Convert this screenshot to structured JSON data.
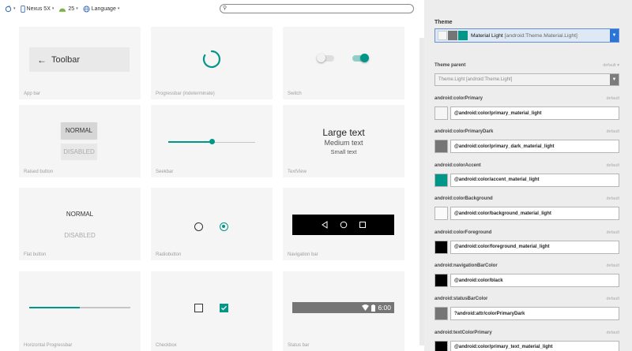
{
  "toolbar": {
    "device": "Nexus 5X",
    "api": "25",
    "language": "Language"
  },
  "cards": [
    {
      "name": "app-bar",
      "label": "App bar",
      "toolbar_title": "Toolbar"
    },
    {
      "name": "progressbar",
      "label": "Progressbar (indeterminate)"
    },
    {
      "name": "switch",
      "label": "Switch"
    },
    {
      "name": "raised-button",
      "label": "Raised button",
      "normal": "NORMAL",
      "disabled": "DISABLED"
    },
    {
      "name": "seekbar",
      "label": "Seekbar",
      "progress": 0.5
    },
    {
      "name": "textview",
      "label": "TextView",
      "large": "Large text",
      "medium": "Medium text",
      "small": "Small text"
    },
    {
      "name": "flat-button",
      "label": "Flat button",
      "normal": "NORMAL",
      "disabled": "DISABLED"
    },
    {
      "name": "radiobutton",
      "label": "Radiobutton"
    },
    {
      "name": "navigation-bar",
      "label": "Navigation bar"
    },
    {
      "name": "horizontal-progressbar",
      "label": "Horizontal Progressbar",
      "progress": 0.5
    },
    {
      "name": "checkbox",
      "label": "Checkbox"
    },
    {
      "name": "status-bar",
      "label": "Status bar",
      "time": "6:00"
    }
  ],
  "panel": {
    "theme_label": "Theme",
    "theme_value": "Material Light",
    "theme_value_detail": "[android:Theme.Material.Light]",
    "theme_parent_label": "Theme parent",
    "theme_parent_default": "default",
    "theme_parent_value": "Theme.Light [android:Theme.Light]",
    "attributes": [
      {
        "name": "android:colorPrimary",
        "default": "default",
        "value": "@android:color/primary_material_light",
        "color": "#f5f5f5"
      },
      {
        "name": "android:colorPrimaryDark",
        "default": "default",
        "value": "@android:color/primary_dark_material_light",
        "color": "#757575"
      },
      {
        "name": "android:colorAccent",
        "default": "default",
        "value": "@android:color/accent_material_light",
        "color": "#009688"
      },
      {
        "name": "android:colorBackground",
        "default": "default",
        "value": "@android:color/background_material_light",
        "color": "#fafafa"
      },
      {
        "name": "android:colorForeground",
        "default": "default",
        "value": "@android:color/foreground_material_light",
        "color": "#000000"
      },
      {
        "name": "android:navigationBarColor",
        "default": "default",
        "value": "@android:color/black",
        "color": "#000000"
      },
      {
        "name": "android:statusBarColor",
        "default": "default",
        "value": "?android:attr/colorPrimaryDark",
        "color": "#757575"
      },
      {
        "name": "android:textColorPrimary",
        "default": "default",
        "value": "@android:color/primary_text_material_light",
        "color": "#000000"
      }
    ]
  },
  "colors": {
    "accent": "#009688",
    "primary_dark": "#757575",
    "dropdown_blue": "#2b74d8"
  }
}
